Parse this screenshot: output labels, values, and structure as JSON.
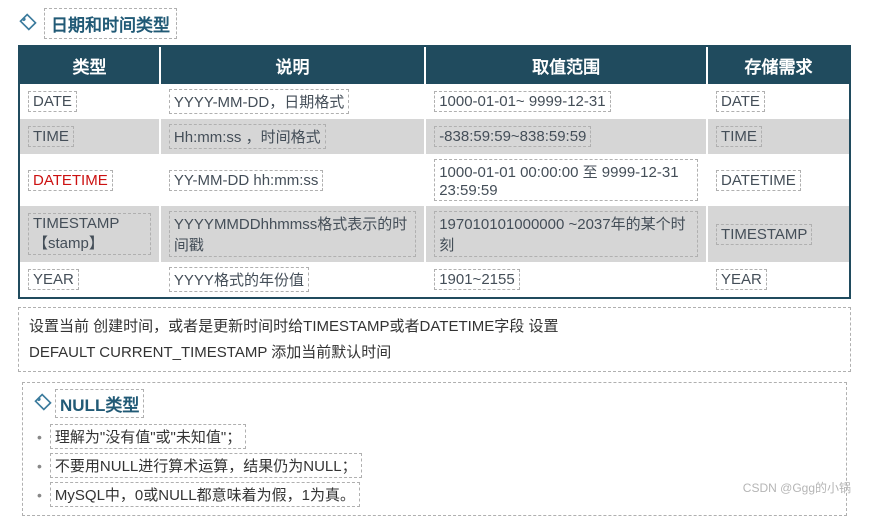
{
  "heading1": "日期和时间类型",
  "table": {
    "headers": [
      "类型",
      "说明",
      "取值范围",
      "存储需求"
    ],
    "rows": [
      {
        "type": "DATE",
        "desc": "YYYY-MM-DD，日期格式",
        "range": "1000-01-01~ 9999-12-31",
        "storage": "DATE",
        "alt": false,
        "red": false
      },
      {
        "type": "TIME",
        "desc": "Hh:mm:ss ，时间格式",
        "range": "-838:59:59~838:59:59",
        "storage": "TIME",
        "alt": true,
        "red": false
      },
      {
        "type": "DATETIME",
        "desc": "YY-MM-DD hh:mm:ss",
        "range": "1000-01-01 00:00:00 至 9999-12-31 23:59:59",
        "storage": "DATETIME",
        "alt": false,
        "red": true
      },
      {
        "type": "TIMESTAMP【stamp】",
        "desc": "YYYYMMDDhhmmss格式表示的时间戳",
        "range": "197010101000000 ~2037年的某个时刻",
        "storage": "TIMESTAMP",
        "alt": true,
        "red": false
      },
      {
        "type": "YEAR",
        "desc": "YYYY格式的年份值",
        "range": "1901~2155",
        "storage": "YEAR",
        "alt": false,
        "red": false
      }
    ]
  },
  "note": {
    "line1": "设置当前 创建时间，或者是更新时间时给TIMESTAMP或者DATETIME字段 设置",
    "line2": "DEFAULT  CURRENT_TIMESTAMP 添加当前默认时间"
  },
  "null_section": {
    "title": "NULL类型",
    "items": [
      "理解为\"没有值\"或\"未知值\"；",
      "不要用NULL进行算术运算，结果仍为NULL；",
      "MySQL中，0或NULL都意味着为假，1为真。"
    ]
  },
  "watermark": "CSDN @Ggg的小锅"
}
